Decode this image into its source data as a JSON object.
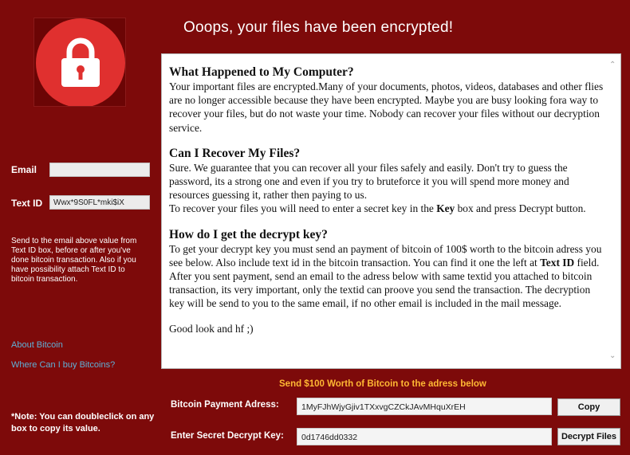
{
  "header": {
    "title": "Ooops, your files have been encrypted!"
  },
  "left": {
    "email_label": "Email",
    "email_value": "",
    "textid_label": "Text ID",
    "textid_value": "Wwx*9S0FL*mki$iX",
    "note": "Send to the email above value from Text ID box, before or after you've done bitcoin transaction. Also if you have possibility attach Text ID to bitcoin transaction.",
    "link_about": "About Bitcoin",
    "link_where": "Where Can I buy Bitcoins?",
    "bottom_note": "*Note: You can doubleclick on any box to copy its value."
  },
  "content": {
    "s1_heading": "What Happened to My Computer?",
    "s1_text": "Your important files are encrypted.Many of your documents, photos, videos, databases and other flies are no longer accessible because they have been encrypted. Maybe you are busy looking fora way to recover your files, but do not waste your time. Nobody can recover your files without our decryption service.",
    "s2_heading": "Can I Recover My Files?",
    "s2_text1": "Sure. We guarantee that you can recover all your files safely and easily. Don't try to guess the password, its a strong one and even if you try to bruteforce it you will spend more money and resources guessing it, rather then paying to us.",
    "s2_text2a": "To recover your files you will need to enter a secret key in the ",
    "s2_text2b": "Key",
    "s2_text2c": " box and press Decrypt button.",
    "s3_heading": "How do I get the decrypt key?",
    "s3_text_a": "To get your decrypt key you must send an payment of bitcoin of 100$ worth to the bitcoin adress you see below. Also include text id in the bitcoin transaction. You can find it one the left at ",
    "s3_text_b": "Text ID",
    "s3_text_c": " field. After you sent payment, send an email to the adress below with same textid you attached to bitcoin transaction, its very important, only the textid can proove you send the transaction. The decryption key will be send to you to the same email, if no other email is included in the mail message.",
    "s4_text": "Good look and hf ;)"
  },
  "payment": {
    "send_title": "Send $100 Worth of Bitcoin to the adress below",
    "address_label": "Bitcoin Payment Adress:",
    "address_value": "1MyFJhWjyGjiv1TXxvgCZCkJAvMHquXrEH",
    "copy_button": "Copy",
    "key_label": "Enter Secret Decrypt Key:",
    "key_value": "0d1746dd0332",
    "decrypt_button": "Decrypt Files"
  },
  "icons": {
    "lock": "lock-icon",
    "scroll_up": "scroll-up-icon",
    "scroll_down": "scroll-down-icon"
  },
  "colors": {
    "background": "#7d0a0a",
    "lock_circle": "#e0302f",
    "send_title": "#ffb833",
    "links": "#5fb0d6"
  }
}
